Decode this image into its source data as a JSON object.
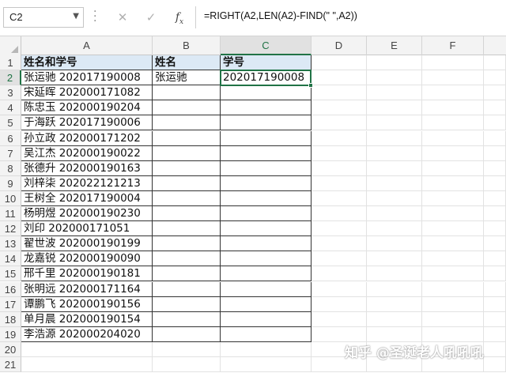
{
  "formula_bar": {
    "name_box": "C2",
    "formula": "=RIGHT(A2,LEN(A2)-FIND(\" \",A2))",
    "cancel_icon": "close-icon",
    "enter_icon": "check-icon",
    "function_label": "fx"
  },
  "columns": [
    "A",
    "B",
    "C",
    "D",
    "E",
    "F",
    ""
  ],
  "rows": [
    "1",
    "2",
    "3",
    "4",
    "5",
    "6",
    "7",
    "8",
    "9",
    "10",
    "11",
    "12",
    "13",
    "14",
    "15",
    "16",
    "17",
    "18",
    "19",
    "20",
    "21"
  ],
  "sheet": {
    "headers": [
      "姓名和学号",
      "姓名",
      "学号"
    ],
    "col_a": [
      "张运驰 202017190008",
      "宋延晖 202000171082",
      "陈忠玉 202000190204",
      "于海跃 202017190006",
      "孙立政 202000171202",
      "吴江杰 202000190022",
      "张德升 202000190163",
      "刘梓柒 202022121213",
      "王树全 202017190004",
      "杨明煜 202000190230",
      "刘印 202000171051",
      "翟世波 202000190199",
      "龙嘉锐 202000190090",
      "邢千里 202000190181",
      "张明远 202000171164",
      "谭鹏飞 202000190156",
      "单月晨 202000190154",
      "李浩源 202000204020"
    ],
    "b2": "张运驰",
    "c2": "202017190008"
  },
  "selection": "C2",
  "watermark": "知乎 @圣诞老人吼吼吼",
  "colors": {
    "accent": "#217346",
    "header_fill": "#dce9f5"
  }
}
